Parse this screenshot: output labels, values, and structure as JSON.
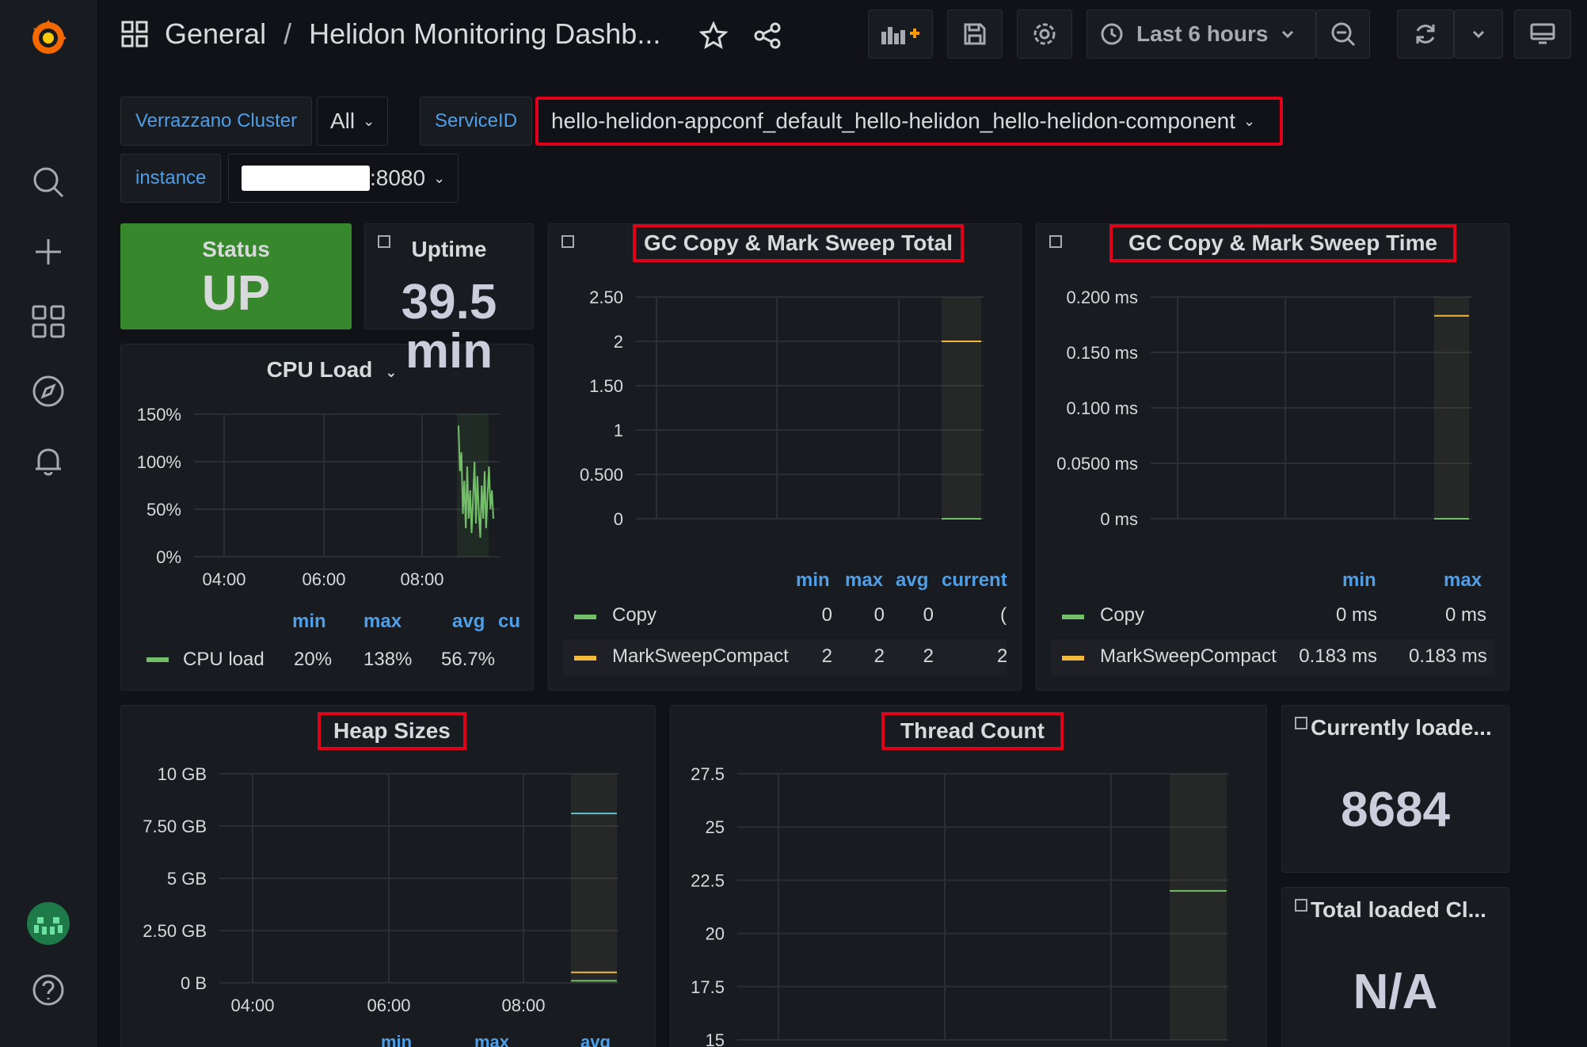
{
  "nav": {
    "folder": "General",
    "separator": "/",
    "dashboard": "Helidon Monitoring Dashb...",
    "time_range": "Last 6 hours"
  },
  "variables": {
    "cluster_label": "Verrazzano Cluster",
    "cluster_value": "All",
    "service_label": "ServiceID",
    "service_value": "hello-helidon-appconf_default_hello-helidon_hello-helidon-component",
    "instance_label": "instance",
    "instance_suffix": ":8080"
  },
  "panels": {
    "status": {
      "title": "Status",
      "value": "UP",
      "color": "#37872d"
    },
    "uptime": {
      "title": "Uptime",
      "value": "39.5",
      "unit": "min"
    },
    "cpu": {
      "title": "CPU Load",
      "legend_headers": [
        "min",
        "max",
        "avg",
        "cu"
      ],
      "series": [
        {
          "name": "CPU load",
          "min": "20%",
          "max": "138%",
          "avg": "56.7%",
          "color": "#73bf69"
        }
      ]
    },
    "gc_total": {
      "title": "GC Copy & Mark Sweep Total",
      "legend_headers": [
        "min",
        "max",
        "avg",
        "current"
      ],
      "rows": [
        {
          "name": "Copy",
          "min": "0",
          "max": "0",
          "avg": "0",
          "current": "(",
          "color": "#73bf69"
        },
        {
          "name": "MarkSweepCompact",
          "min": "2",
          "max": "2",
          "avg": "2",
          "current": "2",
          "color": "#f2b93b"
        }
      ]
    },
    "gc_time": {
      "title": "GC Copy & Mark Sweep Time",
      "legend_headers": [
        "min",
        "max"
      ],
      "rows": [
        {
          "name": "Copy",
          "min": "0 ms",
          "max": "0 ms",
          "color": "#73bf69"
        },
        {
          "name": "MarkSweepCompact",
          "min": "0.183 ms",
          "max": "0.183 ms",
          "color": "#f2b93b"
        }
      ]
    },
    "heap": {
      "title": "Heap Sizes",
      "legend_headers": [
        "min",
        "max",
        "avg"
      ]
    },
    "threads": {
      "title": "Thread Count"
    },
    "loaded_classes": {
      "title": "Currently loade...",
      "value": "8684"
    },
    "total_classes": {
      "title": "Total loaded Cl...",
      "value": "N/A"
    }
  },
  "chart_data": [
    {
      "type": "line",
      "title": "CPU Load",
      "x_ticks": [
        "04:00",
        "06:00",
        "08:00"
      ],
      "y_ticks": [
        "150%",
        "100%",
        "50%",
        "0%"
      ],
      "ylim": [
        0,
        150
      ],
      "series": [
        {
          "name": "CPU load",
          "color": "#73bf69",
          "values": [
            138,
            90,
            110,
            45,
            80,
            30,
            95,
            40,
            70,
            25,
            60,
            100,
            35,
            85,
            45,
            20,
            75,
            40,
            90,
            30,
            65,
            95,
            50,
            70,
            40
          ]
        }
      ]
    },
    {
      "type": "line",
      "title": "GC Copy & Mark Sweep Total",
      "x_ticks": [
        "04:00",
        "06:00",
        "08:00"
      ],
      "y_ticks": [
        "2.50",
        "2",
        "1.50",
        "1",
        "0.500",
        "0"
      ],
      "ylim": [
        0,
        2.5
      ],
      "series": [
        {
          "name": "Copy",
          "color": "#73bf69",
          "value": 0
        },
        {
          "name": "MarkSweepCompact",
          "color": "#f2b93b",
          "value": 2
        }
      ]
    },
    {
      "type": "line",
      "title": "GC Copy & Mark Sweep Time",
      "x_ticks": [
        "04:00",
        "06:00",
        "08:00"
      ],
      "y_ticks": [
        "0.200 ms",
        "0.150 ms",
        "0.100 ms",
        "0.0500 ms",
        "0 ms"
      ],
      "ylim": [
        0,
        0.2
      ],
      "series": [
        {
          "name": "Copy",
          "color": "#73bf69",
          "value": 0
        },
        {
          "name": "MarkSweepCompact",
          "color": "#f2b93b",
          "value": 0.183
        }
      ]
    },
    {
      "type": "line",
      "title": "Heap Sizes",
      "x_ticks": [
        "04:00",
        "06:00",
        "08:00"
      ],
      "y_ticks": [
        "10 GB",
        "7.50 GB",
        "5 GB",
        "2.50 GB",
        "0 B"
      ],
      "ylim": [
        0,
        10
      ],
      "series": [
        {
          "color": "#5ec4cf",
          "value": 8.1
        },
        {
          "color": "#f2b93b",
          "value": 0.5
        },
        {
          "color": "#73bf69",
          "value": 0.1
        }
      ]
    },
    {
      "type": "line",
      "title": "Thread Count",
      "x_ticks": [],
      "y_ticks": [
        "27.5",
        "25",
        "22.5",
        "20",
        "17.5",
        "15"
      ],
      "ylim": [
        15,
        27.5
      ],
      "series": [
        {
          "color": "#73bf69",
          "value": 22
        }
      ]
    }
  ]
}
